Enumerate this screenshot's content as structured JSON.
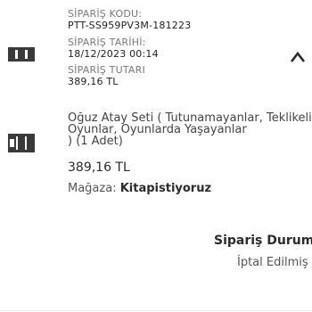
{
  "order": {
    "code_label": "SİPARİŞ KODU:",
    "code_value": "PTT-SS959PV3M-181223",
    "date_label": "SİPARİŞ TARİHİ:",
    "date_value": "18/12/2023 00:14",
    "total_label": "SİPARİŞ TUTARI",
    "total_value": "389,16 TL",
    "toggle_icon": "chevron-up-icon"
  },
  "item": {
    "title": "Oğuz Atay Seti ( Tutunamayanlar, Teklikeli Oyunlar, Oyunlarda Yaşayanlar",
    "quantity": ") (1 Adet)",
    "price": "389,16 TL",
    "store_label": "Mağaza:",
    "store_name": "Kitapistiyoruz"
  },
  "status": {
    "label": "Sipariş Durumu",
    "value": "İptal Edilmiş"
  }
}
